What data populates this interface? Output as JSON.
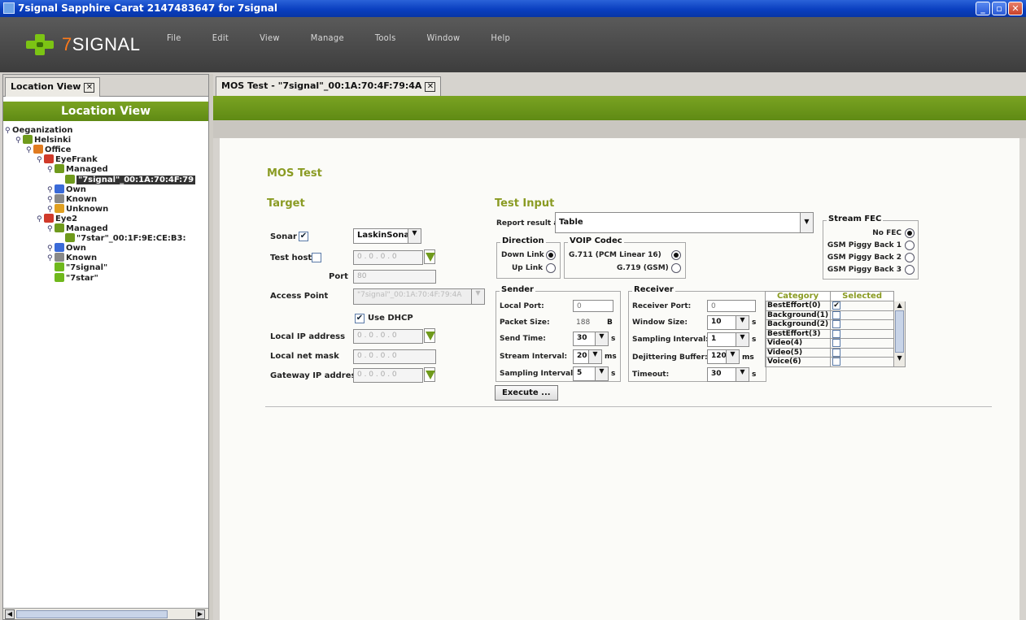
{
  "window": {
    "title": "7signal Sapphire Carat  2147483647 for 7signal"
  },
  "logo": {
    "word_main": "7",
    "word_rest": "SIGNAL"
  },
  "menu": [
    "File",
    "Edit",
    "View",
    "Manage",
    "Tools",
    "Window",
    "Help"
  ],
  "left": {
    "tab_label": "Location View",
    "panel_title": "Location View",
    "tree": [
      {
        "label": "Oeganization",
        "depth": 0
      },
      {
        "label": "Helsinki",
        "depth": 1
      },
      {
        "label": "Office",
        "depth": 2
      },
      {
        "label": "EyeFrank",
        "depth": 3
      },
      {
        "label": "Managed",
        "depth": 4
      },
      {
        "label": "\"7signal\"_00:1A:70:4F:79",
        "depth": 5
      },
      {
        "label": "Own",
        "depth": 4
      },
      {
        "label": "Known",
        "depth": 4
      },
      {
        "label": "Unknown",
        "depth": 4
      },
      {
        "label": "Eye2",
        "depth": 3
      },
      {
        "label": "Managed",
        "depth": 4
      },
      {
        "label": "\"7star\"_00:1F:9E:CE:B3:",
        "depth": 5
      },
      {
        "label": "Own",
        "depth": 4
      },
      {
        "label": "Known",
        "depth": 4
      },
      {
        "label": "\"7signal\"",
        "depth": 4
      },
      {
        "label": "\"7star\"",
        "depth": 4
      }
    ]
  },
  "right": {
    "tab_label": "MOS Test - \"7signal\"_00:1A:70:4F:79:4A",
    "heading": "MOS Test",
    "target": {
      "title": "Target",
      "sonar_label": "Sonar",
      "sonar_value": "LaskinSonar",
      "test_host_label": "Test host",
      "ip_placeholder": "0   .   0   .   0   .   0",
      "port_label": "Port",
      "port_value": "80",
      "access_point_label": "Access Point",
      "access_point_value": "\"7signal\"_00:1A:70:4F:79:4A",
      "use_dhcp_label": "Use DHCP",
      "local_ip_label": "Local IP address",
      "local_mask_label": "Local net mask",
      "gateway_label": "Gateway IP address"
    },
    "test_input": {
      "title": "Test Input",
      "report_label": "Report result as",
      "report_value": "Table",
      "direction": {
        "title": "Direction",
        "down": "Down Link",
        "up": "Up Link"
      },
      "codec": {
        "title": "VOIP Codec",
        "g711": "G.711 (PCM Linear 16)",
        "g719": "G.719 (GSM)"
      },
      "fec": {
        "title": "Stream FEC",
        "options": [
          "No FEC",
          "GSM Piggy Back 1",
          "GSM Piggy Back 2",
          "GSM Piggy Back 3"
        ]
      },
      "sender": {
        "title": "Sender",
        "local_port_label": "Local Port:",
        "local_port": "0",
        "packet_size_label": "Packet Size:",
        "packet_size": "188",
        "packet_unit": "B",
        "send_time_label": "Send Time:",
        "send_time": "30",
        "send_unit": "s",
        "stream_interval_label": "Stream Interval:",
        "stream_interval": "20",
        "stream_unit": "ms",
        "sampling_label": "Sampling Interval:",
        "sampling": "5",
        "sampling_unit": "s"
      },
      "receiver": {
        "title": "Receiver",
        "port_label": "Receiver Port:",
        "port": "0",
        "window_label": "Window Size:",
        "window": "10",
        "window_unit": "s",
        "sampling_label": "Sampling Interval:",
        "sampling": "1",
        "sampling_unit": "s",
        "dejitter_label": "Dejittering Buffer:",
        "dejitter": "120",
        "dejitter_unit": "ms",
        "timeout_label": "Timeout:",
        "timeout": "30",
        "timeout_unit": "s"
      },
      "categories": {
        "col_category": "Category",
        "col_selected": "Selected",
        "rows": [
          {
            "name": "BestEffort(0)",
            "checked": true
          },
          {
            "name": "Background(1)",
            "checked": false
          },
          {
            "name": "Background(2)",
            "checked": false
          },
          {
            "name": "BestEffort(3)",
            "checked": false
          },
          {
            "name": "Video(4)",
            "checked": false
          },
          {
            "name": "Video(5)",
            "checked": false
          },
          {
            "name": "Voice(6)",
            "checked": false
          }
        ]
      },
      "execute_label": "Execute ..."
    }
  },
  "colors": {
    "accent_green": "#6f9a1c",
    "title_blue": "#0a3fc0",
    "olive_text": "#8a9b23"
  }
}
